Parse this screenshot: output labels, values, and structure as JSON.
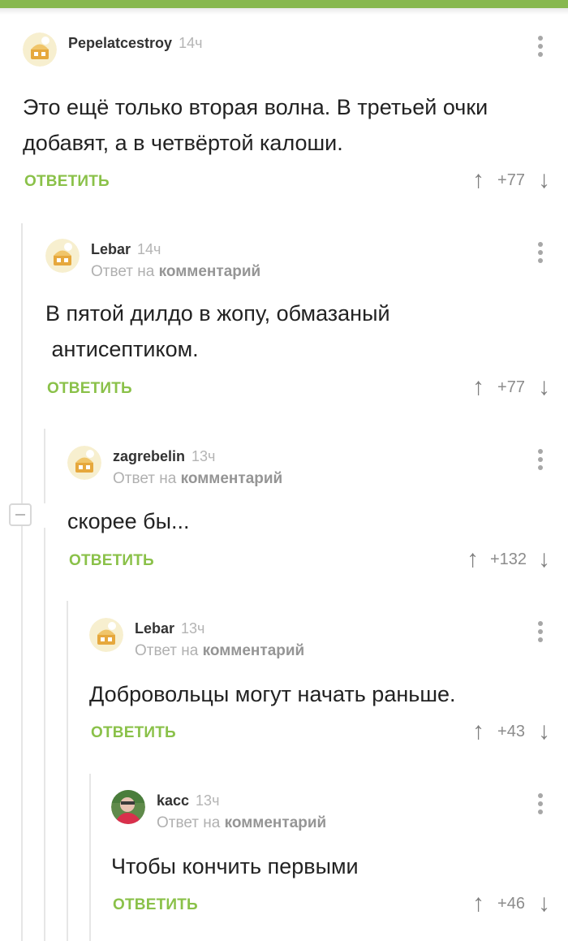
{
  "colors": {
    "accent": "#87b84f",
    "reply_green": "#8ac149"
  },
  "icons": {
    "collapse": "minus-square-icon",
    "menu": "more-vertical-icon",
    "up": "arrow-up-icon",
    "down": "arrow-down-icon"
  },
  "comments": [
    {
      "author": "Pepelatcestroy",
      "time": "14ч",
      "reply_to": null,
      "text": [
        "Это ещё только вторая волна. В третьей очки",
        "добавят, а в четвёртой калоши."
      ],
      "reply_label": "ОТВЕТИТЬ",
      "score": "+77"
    },
    {
      "author": "Lebar",
      "time": "14ч",
      "reply_prefix": "Ответ на",
      "reply_link": "комментарий",
      "text": [
        "В пятой дилдо в жопу, обмазаный",
        " антисептиком."
      ],
      "reply_label": "ОТВЕТИТЬ",
      "score": "+77"
    },
    {
      "author": "zagrebelin",
      "time": "13ч",
      "reply_prefix": "Ответ на",
      "reply_link": "комментарий",
      "text": [
        "скорее бы..."
      ],
      "reply_label": "ОТВЕТИТЬ",
      "score": "+132"
    },
    {
      "author": "Lebar",
      "time": "13ч",
      "reply_prefix": "Ответ на",
      "reply_link": "комментарий",
      "text": [
        "Добровольцы могут начать раньше."
      ],
      "reply_label": "ОТВЕТИТЬ",
      "score": "+43"
    },
    {
      "author": "kacc",
      "time": "13ч",
      "reply_prefix": "Ответ на",
      "reply_link": "комментарий",
      "text": [
        "Чтобы кончить первыми"
      ],
      "reply_label": "ОТВЕТИТЬ",
      "score": "+46"
    }
  ],
  "arrows": {
    "up": "↑",
    "down": "↓"
  }
}
